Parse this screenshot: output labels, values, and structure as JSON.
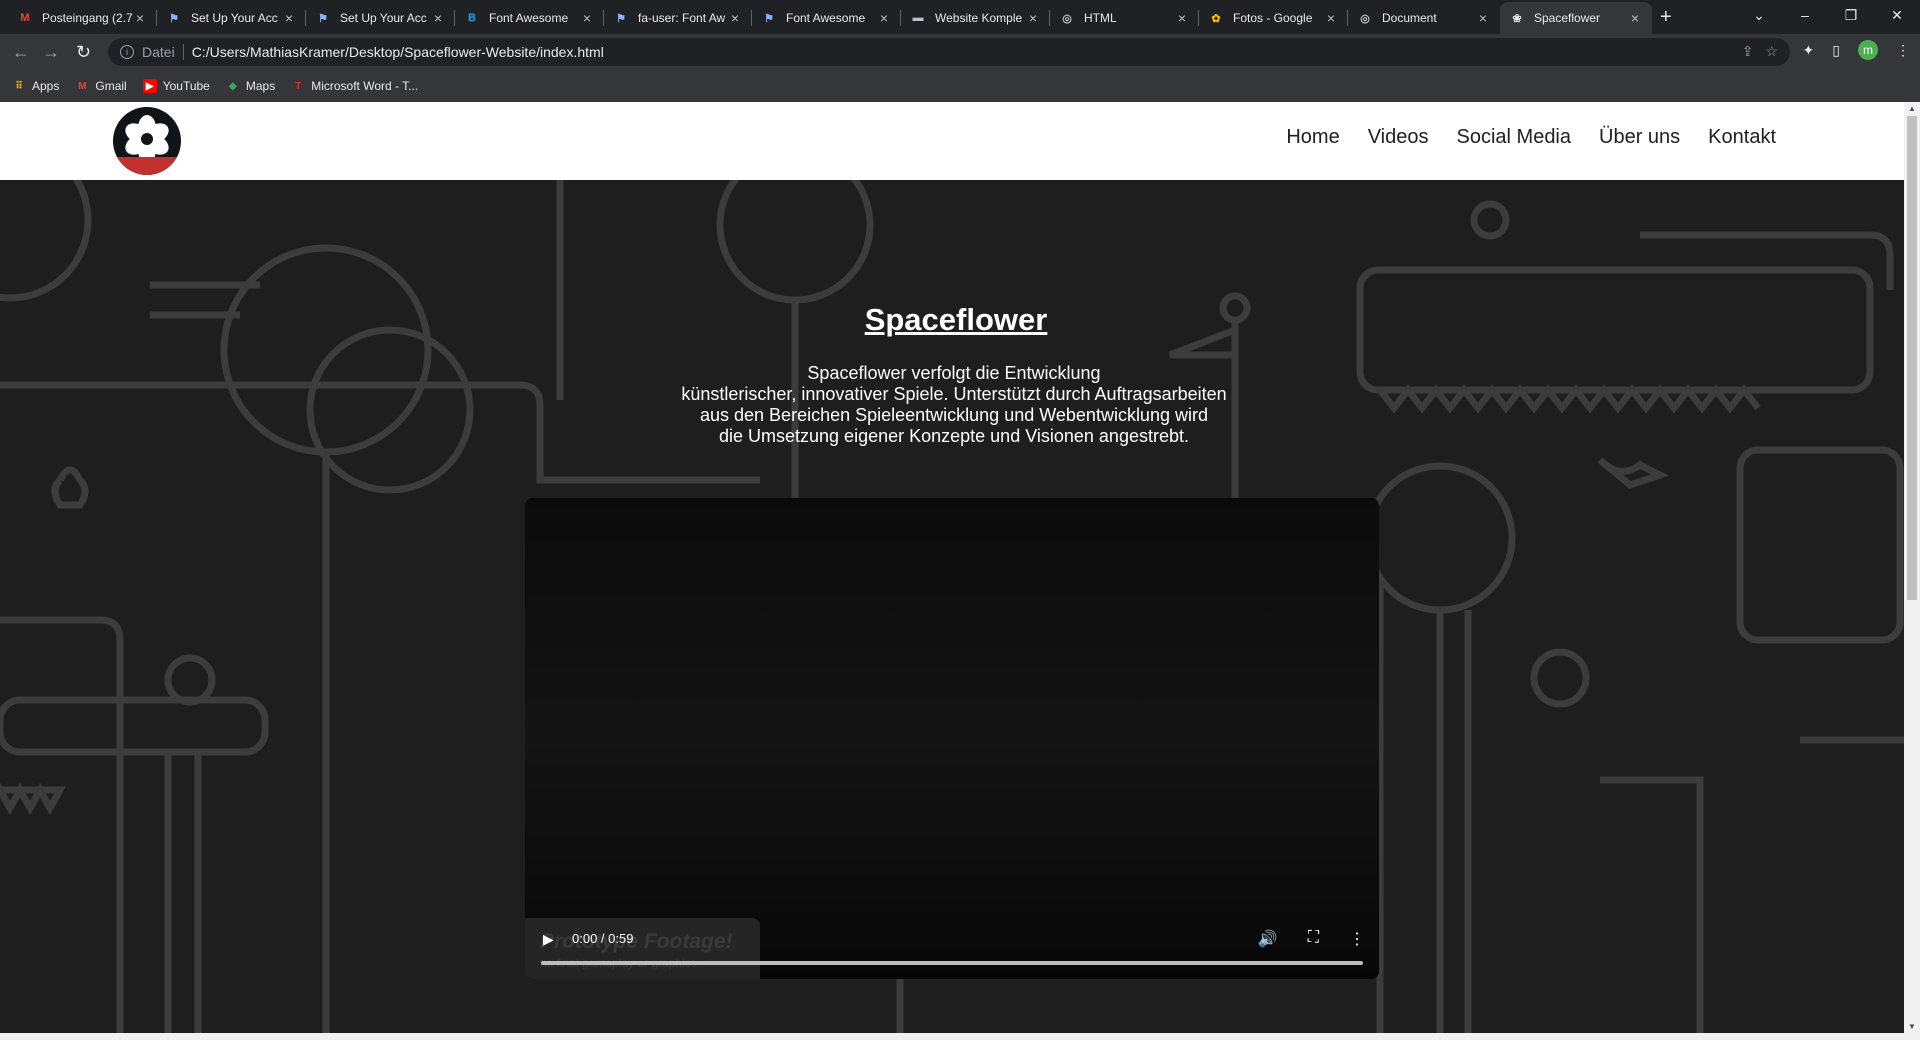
{
  "browser": {
    "tabs": [
      {
        "title": "Posteingang (2.7",
        "favicon": "gmail-icon"
      },
      {
        "title": "Set Up Your Acc",
        "favicon": "flag-icon"
      },
      {
        "title": "Set Up Your Acc",
        "favicon": "flag-icon"
      },
      {
        "title": "Font Awesome",
        "favicon": "bootstrap-icon"
      },
      {
        "title": "fa-user: Font Aw",
        "favicon": "flag-icon"
      },
      {
        "title": "Font Awesome",
        "favicon": "flag-icon"
      },
      {
        "title": "Website Komple",
        "favicon": "site-icon"
      },
      {
        "title": "HTML",
        "favicon": "globe-icon"
      },
      {
        "title": "Fotos - Google",
        "favicon": "photos-icon"
      },
      {
        "title": "Document",
        "favicon": "globe-icon"
      },
      {
        "title": "Spaceflower",
        "favicon": "spaceflower-icon"
      }
    ],
    "address": {
      "scheme_label": "Datei",
      "url": "C:/Users/MathiasKramer/Desktop/Spaceflower-Website/index.html"
    },
    "profile_initial": "m",
    "bookmarks": [
      {
        "label": "Apps",
        "icon": "apps-grid-icon"
      },
      {
        "label": "Gmail",
        "icon": "gmail-icon"
      },
      {
        "label": "YouTube",
        "icon": "youtube-icon"
      },
      {
        "label": "Maps",
        "icon": "maps-icon"
      },
      {
        "label": "Microsoft Word - T...",
        "icon": "word-icon"
      }
    ]
  },
  "site": {
    "nav": [
      "Home",
      "Videos",
      "Social Media",
      "Über uns",
      "Kontakt"
    ],
    "hero": {
      "title": "Spaceflower",
      "lines": [
        "Spaceflower verfolgt die Entwicklung",
        "künstlerischer, innovativer Spiele. Unterstützt durch Auftragsarbeiten",
        "aus den Bereichen Spieleentwicklung und Webentwicklung wird",
        "die Umsetzung eigener Konzepte und Visionen angestrebt."
      ]
    },
    "video": {
      "time": "0:00 / 0:59",
      "progress": 0,
      "card_title": "Prototype Footage!",
      "card_subtitle": "no final gameplay or graphics"
    }
  },
  "colors": {
    "accent_red": "#c2312e",
    "page_bg": "#1e1e1f",
    "line_art": "#3c3c3d"
  }
}
